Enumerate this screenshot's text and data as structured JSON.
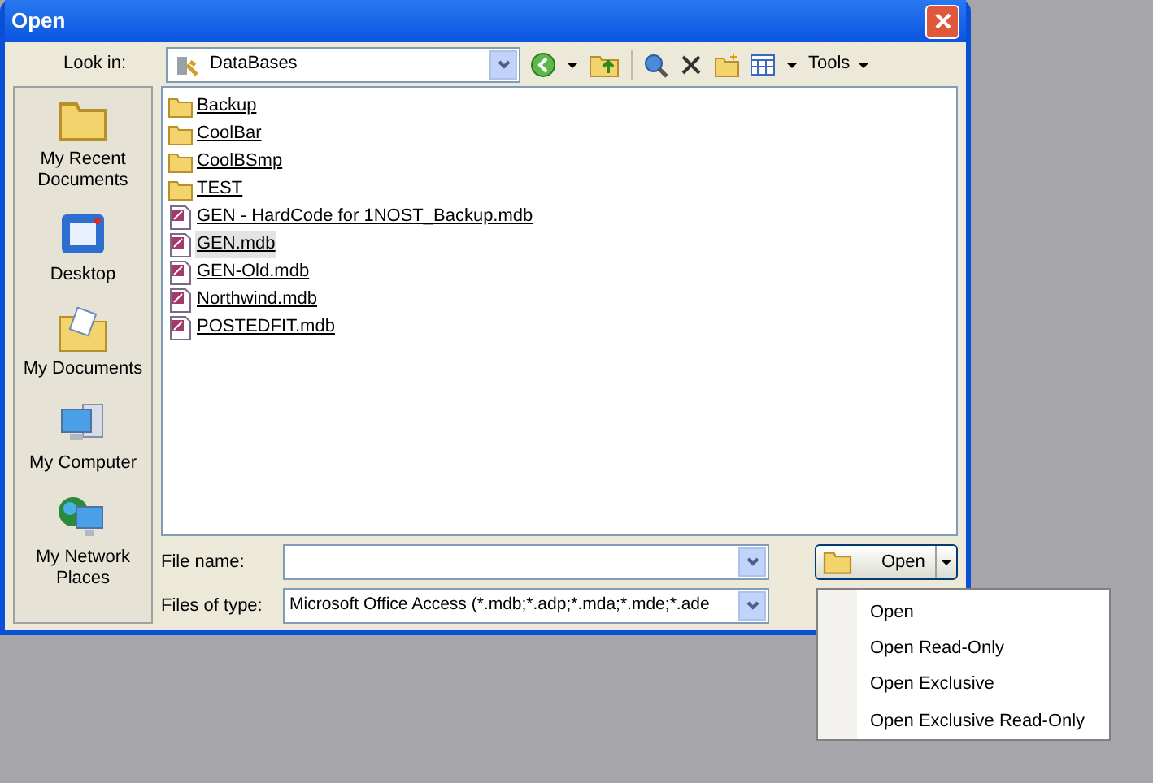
{
  "window": {
    "title": "Open"
  },
  "look_in": {
    "label": "Look in:",
    "value": "DataBases"
  },
  "toolbar": {
    "tools_label": "Tools"
  },
  "places": [
    {
      "kind": "recent",
      "label": "My Recent Documents"
    },
    {
      "kind": "desktop",
      "label": "Desktop"
    },
    {
      "kind": "documents",
      "label": "My Documents"
    },
    {
      "kind": "computer",
      "label": "My Computer"
    },
    {
      "kind": "network",
      "label": "My Network Places"
    }
  ],
  "files": [
    {
      "kind": "folder",
      "name": "Backup",
      "selected": false
    },
    {
      "kind": "folder",
      "name": "CoolBar",
      "selected": false
    },
    {
      "kind": "folder",
      "name": "CoolBSmp",
      "selected": false
    },
    {
      "kind": "folder",
      "name": "TEST",
      "selected": false
    },
    {
      "kind": "database",
      "name": "GEN - HardCode for 1NOST_Backup.mdb",
      "selected": false
    },
    {
      "kind": "database",
      "name": "GEN.mdb",
      "selected": true
    },
    {
      "kind": "database",
      "name": "GEN-Old.mdb",
      "selected": false
    },
    {
      "kind": "database",
      "name": "Northwind.mdb",
      "selected": false
    },
    {
      "kind": "database",
      "name": "POSTEDFIT.mdb",
      "selected": false
    }
  ],
  "file_name": {
    "label": "File name:"
  },
  "file_type": {
    "label": "Files of type:",
    "value": "Microsoft Office Access (*.mdb;*.adp;*.mda;*.mde;*.ade"
  },
  "open_button": {
    "label": "Open"
  },
  "open_menu": [
    "Open",
    "Open Read-Only",
    "Open Exclusive",
    "Open Exclusive Read-Only"
  ]
}
